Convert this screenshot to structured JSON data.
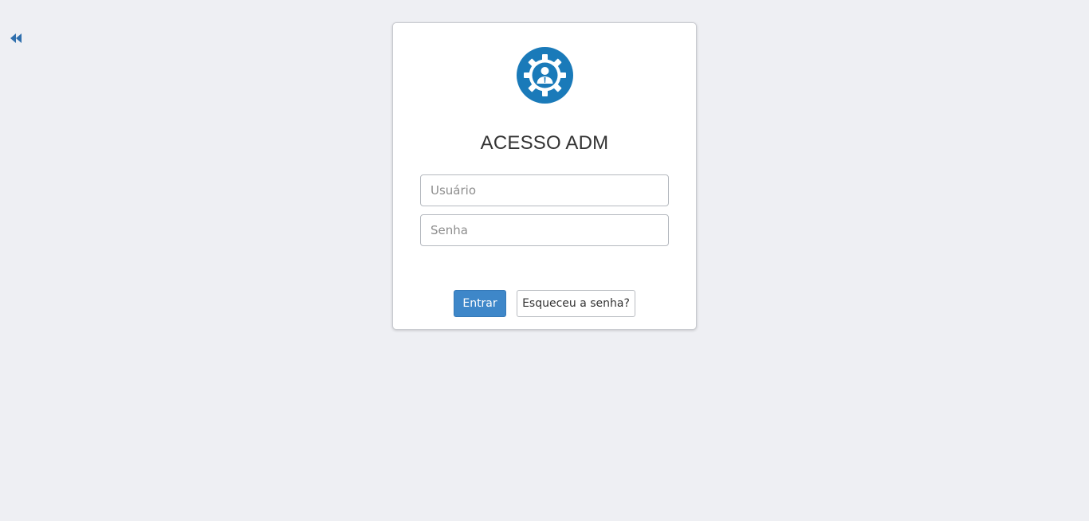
{
  "nav": {
    "back_icon": "rewind-icon",
    "accent": "#2f6fad"
  },
  "login": {
    "logo_icon": "admin-gear-icon",
    "logo_color": "#1a7ab9",
    "title": "ACESSO ADM",
    "username_placeholder": "Usuário",
    "username_value": "",
    "password_placeholder": "Senha",
    "password_value": "",
    "submit_label": "Entrar",
    "forgot_label": "Esqueceu a senha?",
    "primary_color": "#3e87c9"
  }
}
